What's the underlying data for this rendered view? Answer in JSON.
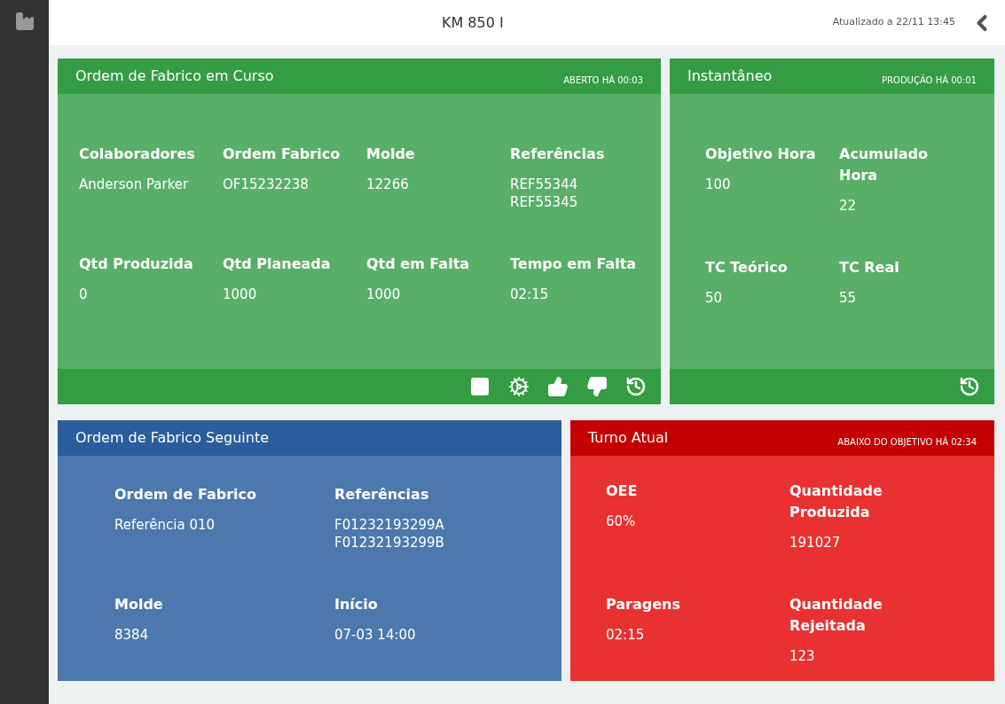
{
  "header": {
    "title": "KM 850 I",
    "updated": "Atualizado a 22/11 13:45"
  },
  "cards": [
    {
      "kind": "current",
      "title": "Ordem de Fabrico em Curso",
      "badge": "ABERTO HÁ 00:03",
      "fields": [
        {
          "label": "Colaboradores",
          "values": [
            "Anderson Parker"
          ]
        },
        {
          "label": "Ordem Fabrico",
          "values": [
            "OF15232238"
          ]
        },
        {
          "label": "Molde",
          "values": [
            "12266"
          ]
        },
        {
          "label": "Referências",
          "values": [
            "REF55344",
            "REF55345"
          ]
        },
        {
          "label": "Qtd Produzida",
          "values": [
            "0"
          ]
        },
        {
          "label": "Qtd Planeada",
          "values": [
            "1000"
          ]
        },
        {
          "label": "Qtd em Falta",
          "values": [
            "1000"
          ]
        },
        {
          "label": "Tempo em Falta",
          "values": [
            "02:15"
          ]
        }
      ]
    },
    {
      "kind": "snapshot",
      "title": "Instantâneo",
      "badge": "PRODUÇÃO HÁ 00:01",
      "fields": [
        {
          "label": "Objetivo Hora",
          "values": [
            "100"
          ]
        },
        {
          "label": "Acumulado Hora",
          "values": [
            "22"
          ]
        },
        {
          "label": "TC Teórico",
          "values": [
            "50"
          ]
        },
        {
          "label": "TC Real",
          "values": [
            "55"
          ]
        }
      ]
    },
    {
      "kind": "next",
      "title": "Ordem de Fabrico Seguinte",
      "fields": [
        {
          "label": "Ordem de Fabrico",
          "values": [
            "Referência 010"
          ]
        },
        {
          "label": "Referências",
          "values": [
            "F01232193299A",
            "F01232193299B"
          ]
        },
        {
          "label": "Molde",
          "values": [
            "8384"
          ]
        },
        {
          "label": "Início",
          "values": [
            "07-03 14:00"
          ]
        }
      ]
    },
    {
      "kind": "shift",
      "title": "Turno Atual",
      "badge": "ABAIXO DO OBJETIVO HÁ 02:34",
      "fields": [
        {
          "label": "OEE",
          "values": [
            "60%"
          ]
        },
        {
          "label": "Quantidade Produzida",
          "values": [
            "191027"
          ]
        },
        {
          "label": "Paragens",
          "values": [
            "02:15"
          ]
        },
        {
          "label": "Quantidade Rejeitada",
          "values": [
            "123"
          ]
        }
      ]
    }
  ]
}
